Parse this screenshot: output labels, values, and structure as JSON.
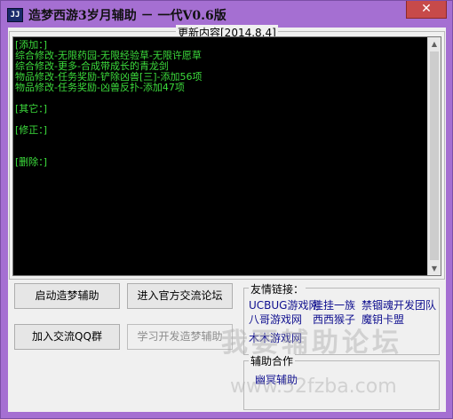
{
  "window": {
    "title": "造梦西游3岁月辅助 － 一代V0.6版",
    "close_symbol": "✕",
    "icon_text": "JJ"
  },
  "update_log": {
    "legend": "更新内容[2014.8.4]",
    "lines": [
      "[添加：]",
      "综合修改-无限药园-无限经验草-无限许愿草",
      "综合修改-更多-合成带成长的青龙剑",
      "物品修改-任务奖励-铲除凶兽[三]-添加56项",
      "物品修改-任务奖励-凶兽反扑-添加47项",
      "[其它：]",
      "[修正：]",
      "[删除：]"
    ]
  },
  "buttons": {
    "launch": "启动造梦辅助",
    "forum": "进入官方交流论坛",
    "join_qq": "加入交流QQ群",
    "learn": "学习开发造梦辅助"
  },
  "friend_links": {
    "legend": "友情链接：",
    "items": [
      "UCBUG游戏网",
      "挂挂一族",
      "禁锢魂开发团队",
      "八哥游戏网",
      "西西猴子",
      "魔钥卡盟",
      "木木游戏网"
    ]
  },
  "partners": {
    "legend": "辅助合作",
    "items": [
      "幽冥辅助"
    ]
  },
  "watermark": {
    "text": "我要辅助论坛",
    "url": "www.52fzba.com"
  },
  "colors": {
    "frame": "#a56fd2",
    "console_bg": "#000000",
    "console_text": "#3cdc3c",
    "link": "#0f0f8f"
  }
}
